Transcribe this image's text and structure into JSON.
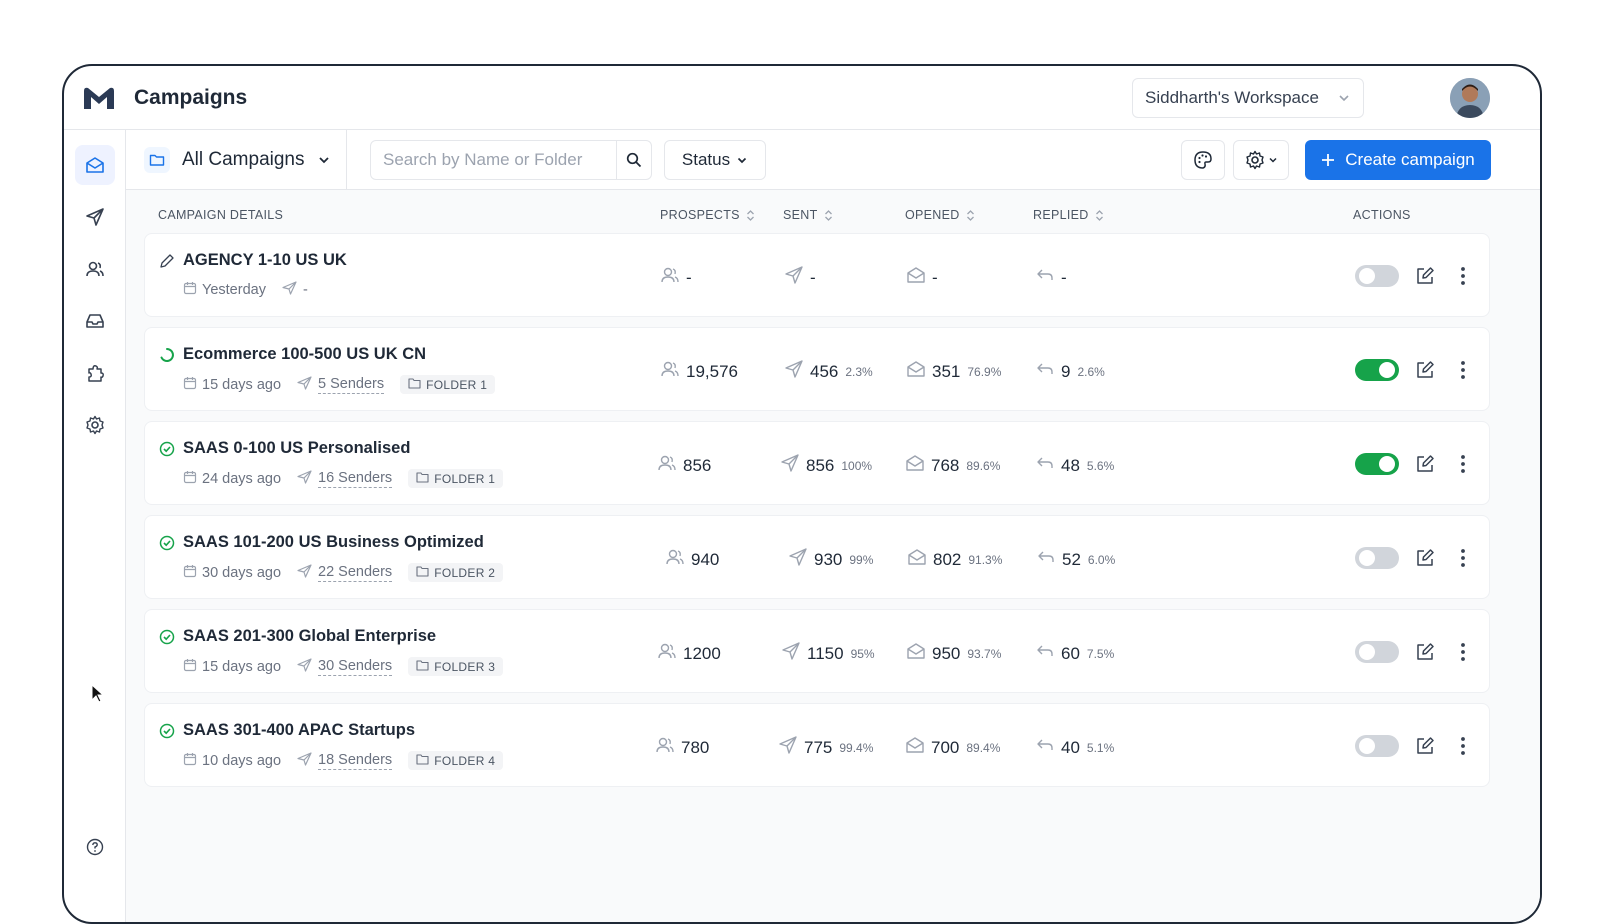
{
  "header": {
    "title": "Campaigns",
    "workspace": "Siddharth's Workspace"
  },
  "sidebar": {
    "items": [
      "mail-icon",
      "send-icon",
      "users-icon",
      "inbox-icon",
      "puzzle-icon",
      "settings-icon"
    ],
    "help": "help-icon"
  },
  "toolbar": {
    "folder_select": "All Campaigns",
    "search_placeholder": "Search by Name or Folder",
    "status_label": "Status",
    "create_label": "Create campaign"
  },
  "table": {
    "headers": {
      "details": "CAMPAIGN DETAILS",
      "prospects": "PROSPECTS",
      "sent": "SENT",
      "opened": "OPENED",
      "replied": "REPLIED",
      "actions": "ACTIONS"
    },
    "rows": [
      {
        "status": "draft",
        "name": "AGENCY 1-10 US UK",
        "date": "Yesterday",
        "senders": "-",
        "folder": "",
        "prospects": "-",
        "sent": "-",
        "sent_pct": "",
        "opened": "-",
        "opened_pct": "",
        "replied": "-",
        "replied_pct": "",
        "active": false
      },
      {
        "status": "running",
        "name": "Ecommerce 100-500 US UK CN",
        "date": "15 days ago",
        "senders": "5 Senders",
        "folder": "FOLDER 1",
        "prospects": "19,576",
        "sent": "456",
        "sent_pct": "2.3%",
        "opened": "351",
        "opened_pct": "76.9%",
        "replied": "9",
        "replied_pct": "2.6%",
        "active": true
      },
      {
        "status": "complete",
        "name": "SAAS 0-100 US Personalised",
        "date": "24 days ago",
        "senders": "16 Senders",
        "folder": "FOLDER 1",
        "prospects": "856",
        "sent": "856",
        "sent_pct": "100%",
        "opened": "768",
        "opened_pct": "89.6%",
        "replied": "48",
        "replied_pct": "5.6%",
        "active": true
      },
      {
        "status": "complete",
        "name": "SAAS 101-200 US Business Optimized",
        "date": "30 days ago",
        "senders": "22 Senders",
        "folder": "FOLDER 2",
        "prospects": "940",
        "sent": "930",
        "sent_pct": "99%",
        "opened": "802",
        "opened_pct": "91.3%",
        "replied": "52",
        "replied_pct": "6.0%",
        "active": false
      },
      {
        "status": "complete",
        "name": "SAAS 201-300 Global Enterprise",
        "date": "15 days ago",
        "senders": "30 Senders",
        "folder": "FOLDER 3",
        "prospects": "1200",
        "sent": "1150",
        "sent_pct": "95%",
        "opened": "950",
        "opened_pct": "93.7%",
        "replied": "60",
        "replied_pct": "7.5%",
        "active": false
      },
      {
        "status": "complete",
        "name": "SAAS 301-400 APAC Startups",
        "date": "10 days ago",
        "senders": "18 Senders",
        "folder": "FOLDER 4",
        "prospects": "780",
        "sent": "775",
        "sent_pct": "99.4%",
        "opened": "700",
        "opened_pct": "89.4%",
        "replied": "40",
        "replied_pct": "5.1%",
        "active": false
      }
    ]
  },
  "colors": {
    "accent": "#1a73e8",
    "toggle_on": "#16a34a",
    "status_complete": "#16a34a"
  }
}
